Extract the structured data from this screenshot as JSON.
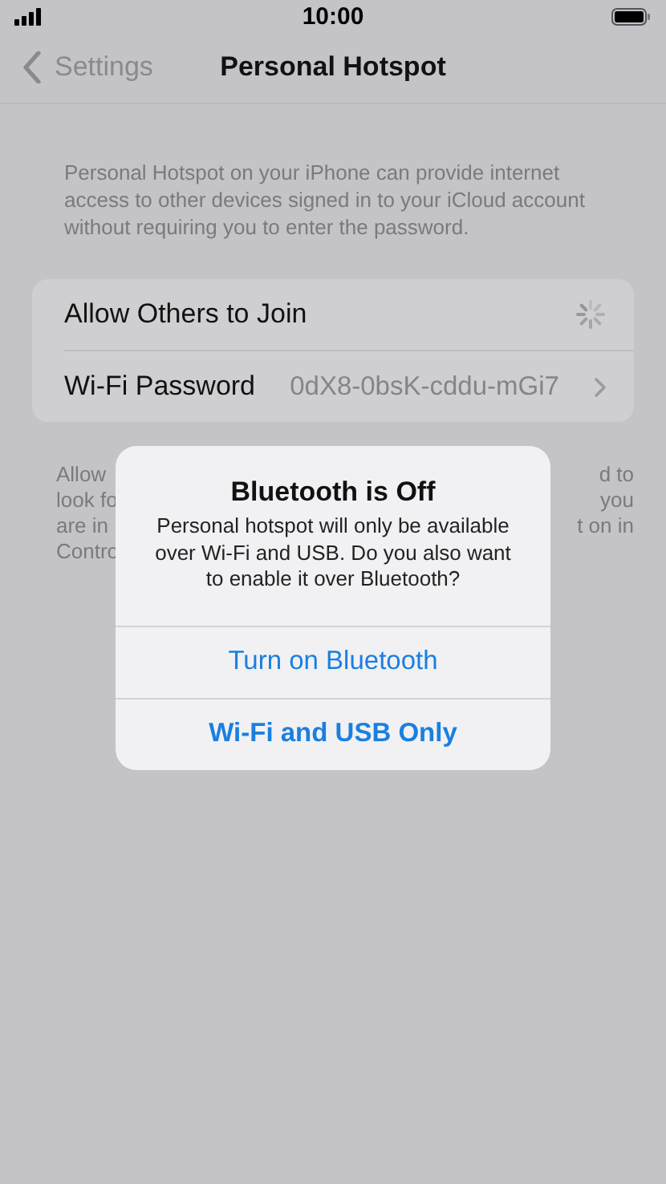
{
  "status_bar": {
    "time": "10:00"
  },
  "nav": {
    "back_label": "Settings",
    "title": "Personal Hotspot"
  },
  "description": "Personal Hotspot on your iPhone can provide internet access to other devices signed in to your iCloud account without requiring you to enter the password.",
  "settings": [
    {
      "kind": "loading",
      "label": "Allow Others to Join"
    },
    {
      "kind": "link",
      "label": "Wi-Fi Password",
      "value": "0dX8-0bsK-cddu-mGi7"
    }
  ],
  "footer_lines": [
    {
      "left": "Allow",
      "right": "d to"
    },
    {
      "left": "look fo",
      "right": "you"
    },
    {
      "left": "are in",
      "right": "t on in"
    },
    {
      "left": "Contro"
    }
  ],
  "alert": {
    "title": "Bluetooth is Off",
    "message": "Personal hotspot will only be available over Wi-Fi and USB. Do you also want to enable it over Bluetooth?",
    "buttons": [
      {
        "label": "Turn on Bluetooth",
        "default": false
      },
      {
        "label": "Wi-Fi and USB Only",
        "default": true
      }
    ]
  }
}
